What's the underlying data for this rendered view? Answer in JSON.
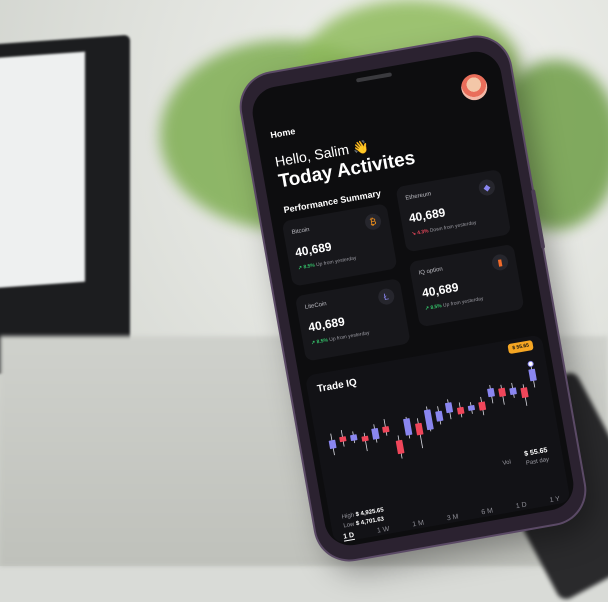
{
  "home": {
    "label": "Home"
  },
  "greeting": {
    "text": "Hello, Salim",
    "emoji": "👋"
  },
  "title": "Today Activites",
  "summary": {
    "section_title": "Performance Summary",
    "cards": [
      {
        "name": "Bitcoin",
        "value": "40,689",
        "change": "8.5%",
        "change_text": "Up from yesterday",
        "direction": "up",
        "icon": "₿"
      },
      {
        "name": "Ethereum",
        "value": "40,689",
        "change": "4.3%",
        "change_text": "Down from yesterday",
        "direction": "down",
        "icon": "◆"
      },
      {
        "name": "LiteCoin",
        "value": "40,689",
        "change": "8.5%",
        "change_text": "Up from yesterday",
        "direction": "up",
        "icon": "Ł"
      },
      {
        "name": "IQ option",
        "value": "40,689",
        "change": "8.5%",
        "change_text": "Up from yesterday",
        "direction": "up",
        "icon": "▮"
      }
    ]
  },
  "trade": {
    "title": "Trade IQ",
    "price_tag": "$ 55.65",
    "vol_label": "Vol",
    "vol_value": "$ 55.65",
    "vol_period": "Past day",
    "high_label": "High",
    "high_value": "$ 4,925.65",
    "low_label": "Low",
    "low_value": "$ 4,701.63",
    "timeframes": [
      "1 D",
      "1 W",
      "1 M",
      "3 M",
      "6 M",
      "1 D",
      "1 Y"
    ],
    "active_timeframe": "1 D",
    "colors": {
      "up": "#8a86f0",
      "down": "#f0465a",
      "wick": "#d8d8e0"
    }
  },
  "chart_data": {
    "type": "candlestick",
    "candles": [
      {
        "o": 40,
        "c": 50,
        "h": 58,
        "l": 32
      },
      {
        "o": 52,
        "c": 46,
        "h": 60,
        "l": 40
      },
      {
        "o": 45,
        "c": 52,
        "h": 56,
        "l": 42
      },
      {
        "o": 48,
        "c": 42,
        "h": 52,
        "l": 30
      },
      {
        "o": 42,
        "c": 55,
        "h": 60,
        "l": 38
      },
      {
        "o": 55,
        "c": 48,
        "h": 64,
        "l": 44
      },
      {
        "o": 36,
        "c": 20,
        "h": 42,
        "l": 14
      },
      {
        "o": 40,
        "c": 60,
        "h": 62,
        "l": 36
      },
      {
        "o": 52,
        "c": 38,
        "h": 58,
        "l": 22
      },
      {
        "o": 42,
        "c": 66,
        "h": 70,
        "l": 40
      },
      {
        "o": 50,
        "c": 62,
        "h": 68,
        "l": 46
      },
      {
        "o": 58,
        "c": 70,
        "h": 74,
        "l": 50
      },
      {
        "o": 62,
        "c": 54,
        "h": 68,
        "l": 50
      },
      {
        "o": 56,
        "c": 62,
        "h": 66,
        "l": 52
      },
      {
        "o": 64,
        "c": 54,
        "h": 70,
        "l": 48
      },
      {
        "o": 68,
        "c": 78,
        "h": 82,
        "l": 60
      },
      {
        "o": 76,
        "c": 66,
        "h": 80,
        "l": 56
      },
      {
        "o": 66,
        "c": 74,
        "h": 80,
        "l": 62
      },
      {
        "o": 72,
        "c": 60,
        "h": 76,
        "l": 50
      },
      {
        "o": 78,
        "c": 92,
        "h": 96,
        "l": 70
      }
    ],
    "ylim": [
      0,
      100
    ]
  }
}
